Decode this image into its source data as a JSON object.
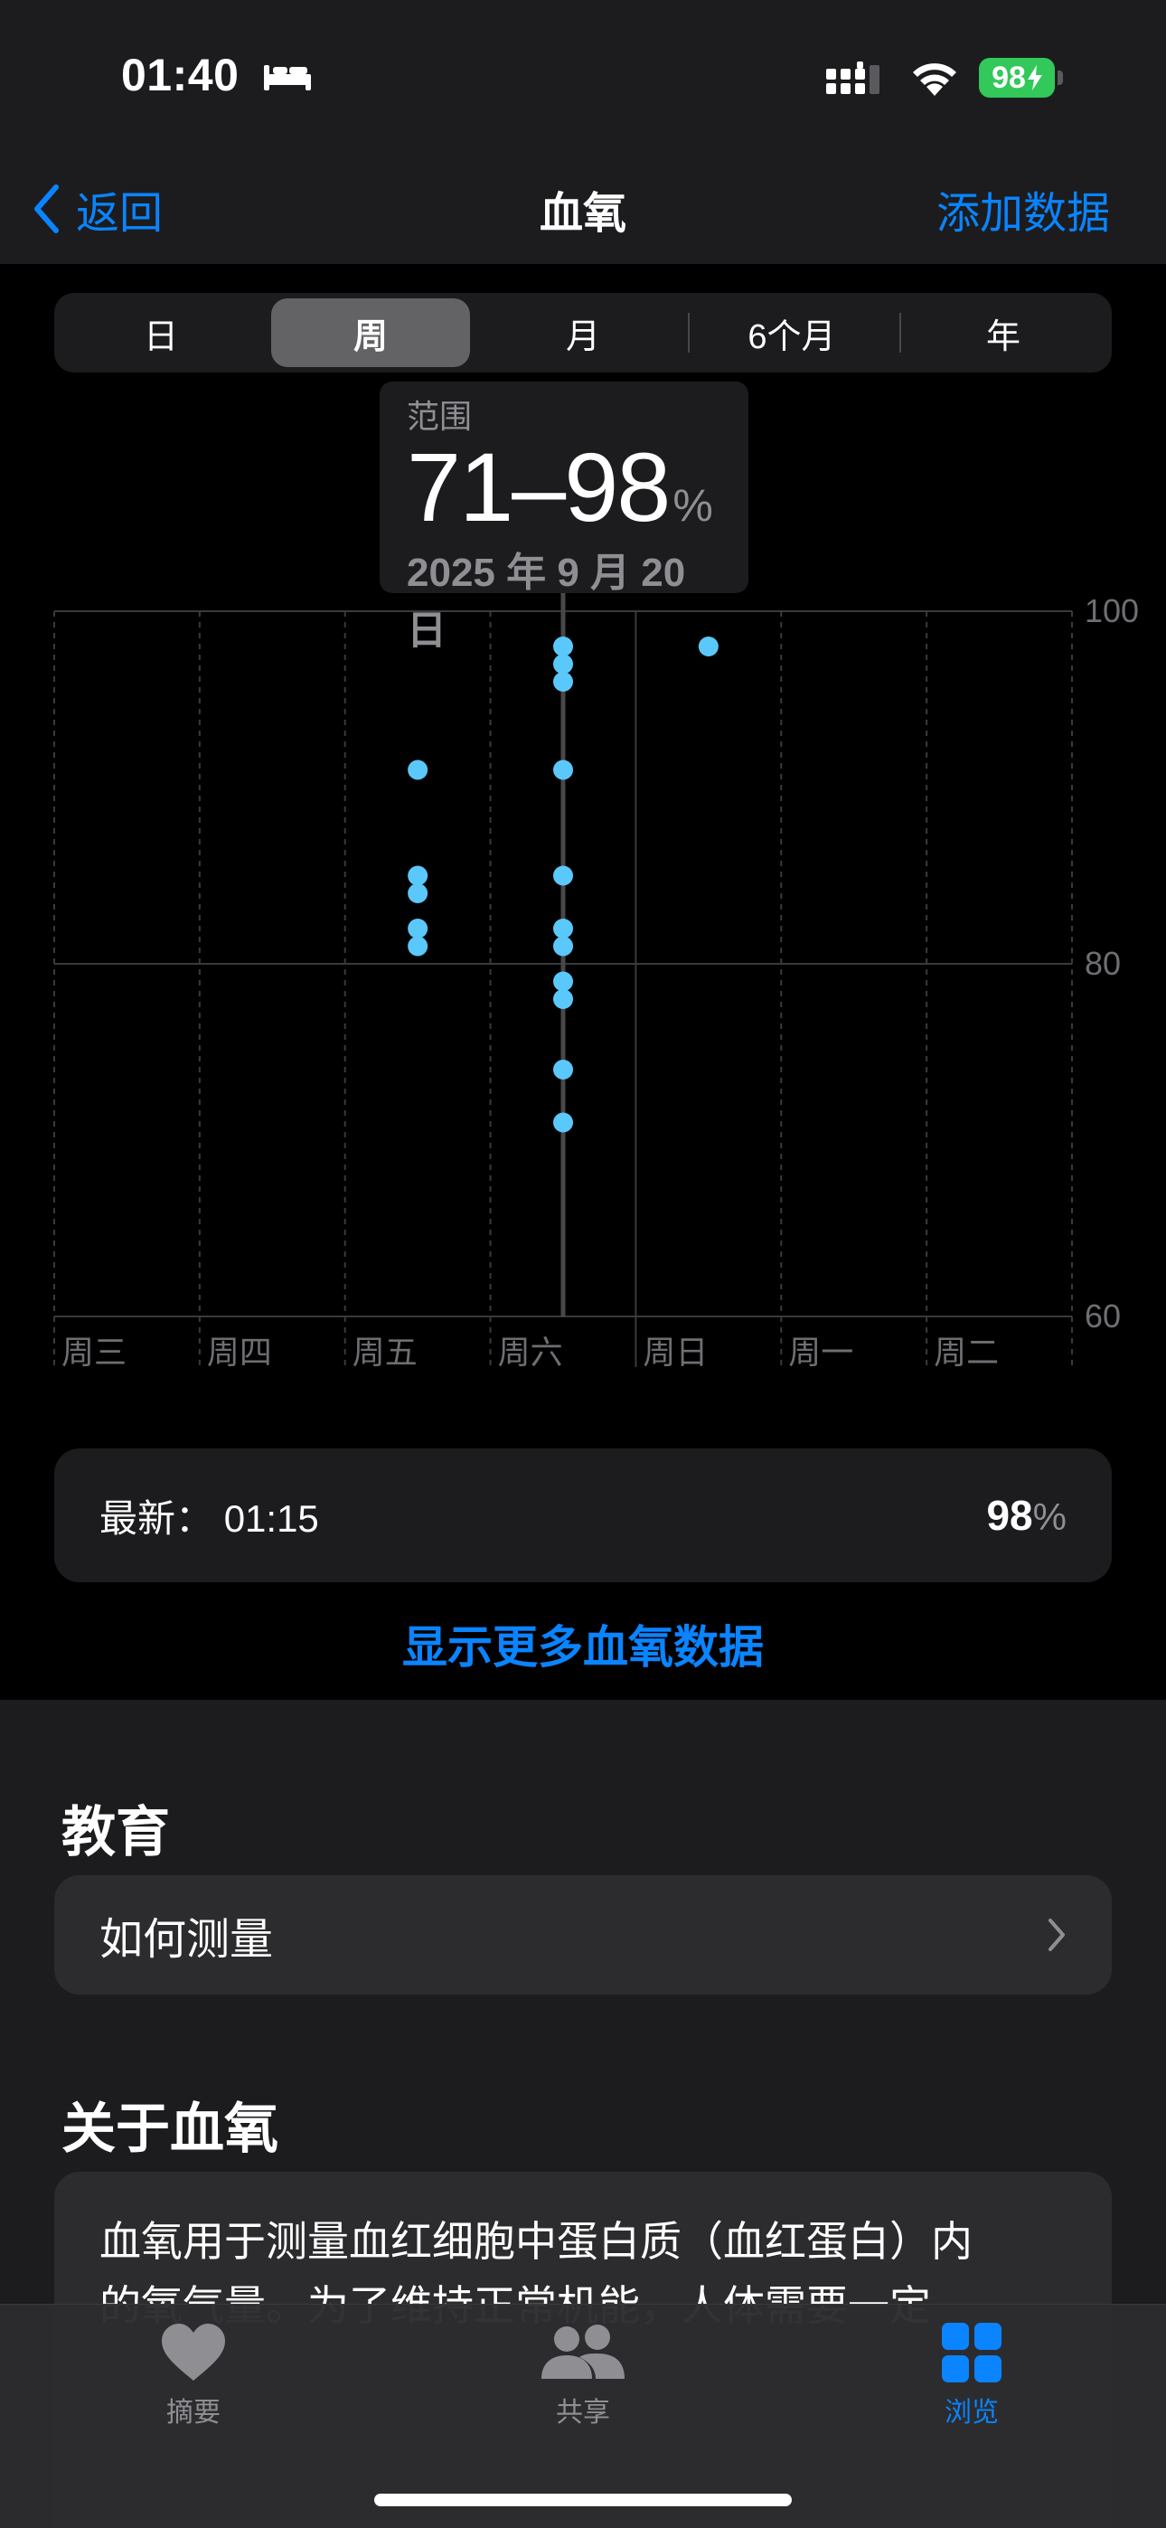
{
  "status_bar": {
    "time": "01:40",
    "battery": "98"
  },
  "nav": {
    "back_label": "返回",
    "title": "血氧",
    "action_label": "添加数据"
  },
  "segments": [
    "日",
    "周",
    "月",
    "6个月",
    "年"
  ],
  "selected_segment": "周",
  "tooltip": {
    "label": "范围",
    "value": "71–98",
    "unit": "%",
    "date": "2025 年 9 月 20 日"
  },
  "chart_data": {
    "type": "scatter",
    "categories": [
      "周三",
      "周四",
      "周五",
      "周六",
      "周日",
      "周一",
      "周二"
    ],
    "ylim": [
      60,
      100
    ],
    "y_ticks": [
      "100",
      "80",
      "60"
    ],
    "grid": true,
    "selected_category": "周六",
    "series": [
      {
        "points": [
          {
            "day": "周五",
            "value": 91
          },
          {
            "day": "周五",
            "value": 85
          },
          {
            "day": "周五",
            "value": 84
          },
          {
            "day": "周五",
            "value": 82
          },
          {
            "day": "周五",
            "value": 81
          },
          {
            "day": "周六",
            "value": 98
          },
          {
            "day": "周六",
            "value": 97
          },
          {
            "day": "周六",
            "value": 96
          },
          {
            "day": "周六",
            "value": 91
          },
          {
            "day": "周六",
            "value": 85
          },
          {
            "day": "周六",
            "value": 82
          },
          {
            "day": "周六",
            "value": 81
          },
          {
            "day": "周六",
            "value": 79
          },
          {
            "day": "周六",
            "value": 78
          },
          {
            "day": "周六",
            "value": 74
          },
          {
            "day": "周六",
            "value": 71
          },
          {
            "day": "周日",
            "value": 98
          }
        ]
      }
    ]
  },
  "latest": {
    "label": "最新：",
    "time": "01:15",
    "value": "98",
    "unit": "%"
  },
  "show_more": "显示更多血氧数据",
  "education": {
    "title": "教育",
    "item": "如何测量"
  },
  "about": {
    "title": "关于血氧",
    "text_line1": "血氧用于测量血红细胞中蛋白质（血红蛋白）内",
    "text_line2": "的氧气量。为了维持正常机能，人体需要一定"
  },
  "tabs": [
    {
      "label": "摘要",
      "icon": "heart-icon"
    },
    {
      "label": "共享",
      "icon": "people-icon"
    },
    {
      "label": "浏览",
      "icon": "grid-icon"
    }
  ],
  "colors": {
    "accent": "#0a84ff",
    "dot": "#5ac8fa",
    "battery": "#32c85a"
  }
}
